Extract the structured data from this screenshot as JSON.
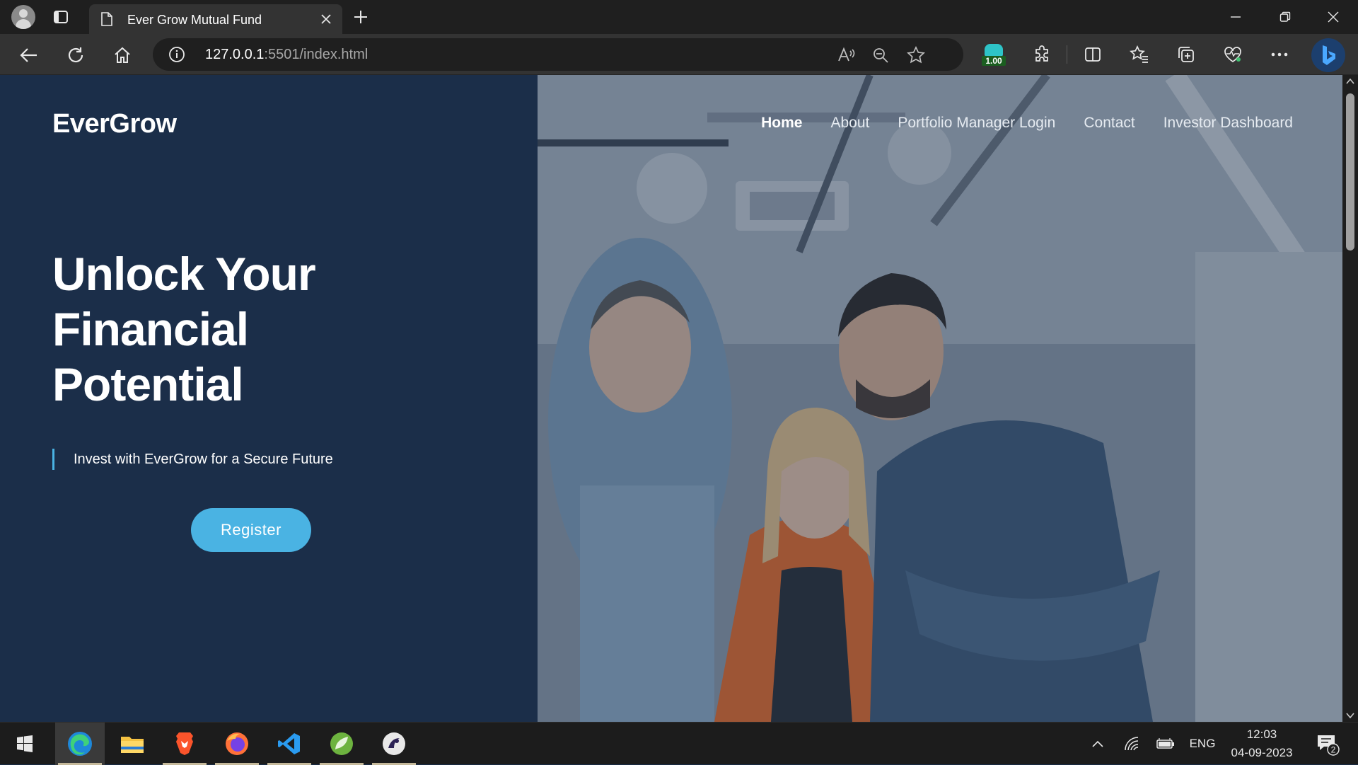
{
  "browser": {
    "tab_title": "Ever Grow Mutual Fund",
    "url_host": "127.0.0.1",
    "url_rest": ":5501/index.html",
    "extension_badge": "1.00"
  },
  "site": {
    "brand": "EverGrow",
    "nav": [
      {
        "label": "Home",
        "active": true
      },
      {
        "label": "About"
      },
      {
        "label": "Portfolio Manager Login"
      },
      {
        "label": "Contact"
      },
      {
        "label": "Investor Dashboard"
      }
    ],
    "hero": {
      "line1": "Unlock Your",
      "line2": "Financial",
      "line3": "Potential",
      "subtitle": "Invest with EverGrow for a Secure Future",
      "cta": "Register"
    }
  },
  "taskbar": {
    "apps": [
      "edge-icon",
      "file-explorer-icon",
      "brave-icon",
      "firefox-icon",
      "vscode-icon",
      "spring-tools-icon",
      "eclipse-icon"
    ],
    "language": "ENG",
    "time": "12:03",
    "date": "04-09-2023",
    "notification_count": "2"
  },
  "colors": {
    "left_panel": "#1b2e49",
    "accent": "#4ab3e3",
    "tab_bar": "#1f1f1f",
    "toolbar": "#333333"
  }
}
